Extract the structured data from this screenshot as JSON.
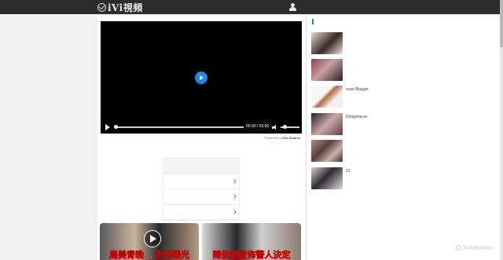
{
  "header": {
    "logo_text": "iVi視頻",
    "nav_items": [
      "",
      "",
      "",
      "",
      "",
      "",
      "",
      "",
      "",
      ""
    ],
    "user_icon": "user-icon"
  },
  "player": {
    "time": "00:00 / 00:00",
    "powered_by_prefix": "Powered by",
    "powered_by_brand": "Glia Studios",
    "accent_color": "#1e88e5"
  },
  "main": {
    "caption": "",
    "menu": {
      "header": "",
      "rows": [
        "",
        "",
        ""
      ]
    },
    "thumbnails": [
      {
        "title": "周美青晚… 生活曝光"
      },
      {
        "title": "陳依珊宣佈警人決定"
      }
    ]
  },
  "sidebar": {
    "heading": "",
    "items": [
      {
        "title": ""
      },
      {
        "title": ""
      },
      {
        "title": "sean Maggie"
      },
      {
        "title": "Dongeeuran"
      },
      {
        "title": ""
      },
      {
        "title": "21"
      }
    ]
  },
  "watermark": "ScanMalware"
}
